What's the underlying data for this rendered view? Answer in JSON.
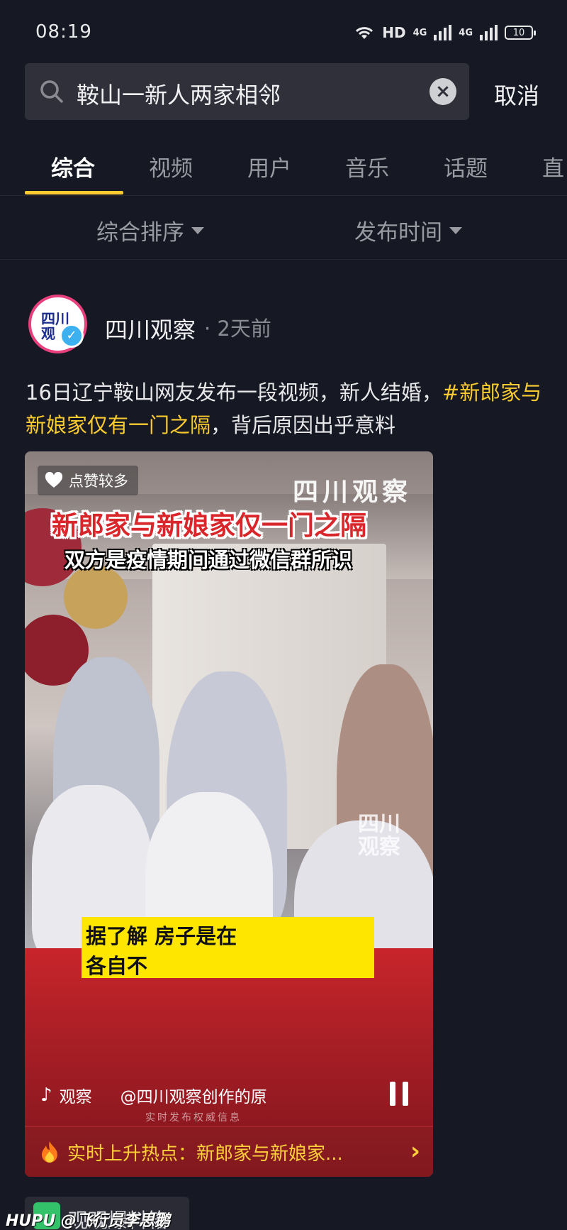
{
  "status_bar": {
    "time": "08:19",
    "network": "HD",
    "signal1": "4G",
    "signal2": "4G",
    "battery": "10"
  },
  "search": {
    "query": "鞍山一新人两家相邻",
    "cancel_label": "取消"
  },
  "tabs": [
    {
      "label": "综合",
      "active": true
    },
    {
      "label": "视频"
    },
    {
      "label": "用户"
    },
    {
      "label": "音乐"
    },
    {
      "label": "话题"
    },
    {
      "label": "直"
    }
  ],
  "sort": {
    "order_label": "综合排序",
    "time_label": "发布时间"
  },
  "post": {
    "avatar_text": "四川观",
    "author": "四川观察",
    "meta": "· 2天前",
    "caption_plain_1": "16日辽宁鞍山网友发布一段视频，新人结婚，",
    "caption_hashtag": "#新郎家与新娘家仅有一门之隔",
    "caption_plain_2": "，背后原因出乎意料"
  },
  "video": {
    "badge": "点赞较多",
    "watermark_top": "四川观察",
    "title": "新郎家与新娘家仅一门之隔",
    "subtitle": "双方是疫情期间通过微信群所识",
    "watermark_mid": "四川观察",
    "sub_line1": "据了解 房子是在",
    "sub_line2": "各自不",
    "tiktok_label": "观察",
    "tiktok_author": "@四川观察创作的原",
    "tagline": "实时发布权威信息",
    "hot_text": "实时上升热点：新郎家与新娘家...",
    "colors": {
      "accent": "#f9cb2f",
      "hot": "#ffd03a",
      "subtitle_box": "#ffe600"
    }
  },
  "bottom": {
    "chip_text": "观观爆料箱",
    "watermark": "HUPU @飞行员李思鹅"
  }
}
